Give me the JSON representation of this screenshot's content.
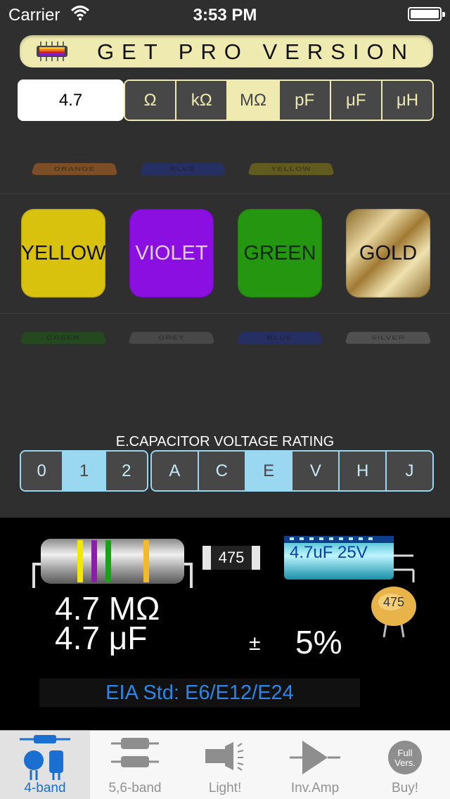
{
  "status_bar": {
    "carrier": "Carrier",
    "time": "3:53 PM"
  },
  "banner": {
    "label": "GET PRO VERSION"
  },
  "value_input": {
    "value": "4.7"
  },
  "units": [
    {
      "label": "Ω",
      "selected": false
    },
    {
      "label": "kΩ",
      "selected": false
    },
    {
      "label": "MΩ",
      "selected": true
    },
    {
      "label": "pF",
      "selected": false
    },
    {
      "label": "μF",
      "selected": false
    },
    {
      "label": "μH",
      "selected": false
    }
  ],
  "picker_above": [
    "ORANGE",
    "BLUE",
    "YELLOW"
  ],
  "bands": [
    {
      "label": "YELLOW",
      "color": "#d8c20d",
      "text_color": "#111111"
    },
    {
      "label": "VIOLET",
      "color": "#8a0fe0",
      "text_color": "#e0d0f0"
    },
    {
      "label": "GREEN",
      "color": "#259610",
      "text_color": "#0c2a08"
    },
    {
      "label": "GOLD",
      "color": "#b8923c",
      "text_color": "#111111"
    }
  ],
  "picker_below": [
    "GREEN",
    "GREY",
    "BLUE",
    "SILVER"
  ],
  "voltage": {
    "label": "E.CAPACITOR VOLTAGE RATING",
    "digits": [
      {
        "label": "0",
        "selected": false
      },
      {
        "label": "1",
        "selected": true
      },
      {
        "label": "2",
        "selected": false
      }
    ],
    "letters": [
      {
        "label": "A",
        "selected": false
      },
      {
        "label": "C",
        "selected": false
      },
      {
        "label": "E",
        "selected": true
      },
      {
        "label": "V",
        "selected": false
      },
      {
        "label": "H",
        "selected": false
      },
      {
        "label": "J",
        "selected": false
      }
    ]
  },
  "result": {
    "resistance": "4.7 MΩ",
    "capacitance": "4.7 μF",
    "tolerance_sign": "±",
    "tolerance": "5%",
    "smd_code": "475",
    "ecap_label": "4.7uF 25V",
    "ceramic_code": "475",
    "eia": "EIA Std: E6/E12/E24"
  },
  "tabs": [
    {
      "label": "4-band",
      "icon": "resistor-capacitor-icon",
      "selected": true
    },
    {
      "label": "5,6-band",
      "icon": "two-resistors-icon",
      "selected": false
    },
    {
      "label": "Light!",
      "icon": "flashlight-icon",
      "selected": false
    },
    {
      "label": "Inv.Amp",
      "icon": "op-amp-icon",
      "selected": false
    },
    {
      "label": "Buy!",
      "icon": "full-version-icon",
      "icon_text": "Full Vers.",
      "selected": false
    }
  ],
  "colors": {
    "accent": "#eeeab0",
    "voltage_accent": "#9ad8f2",
    "tab_active": "#1b6fd0"
  }
}
